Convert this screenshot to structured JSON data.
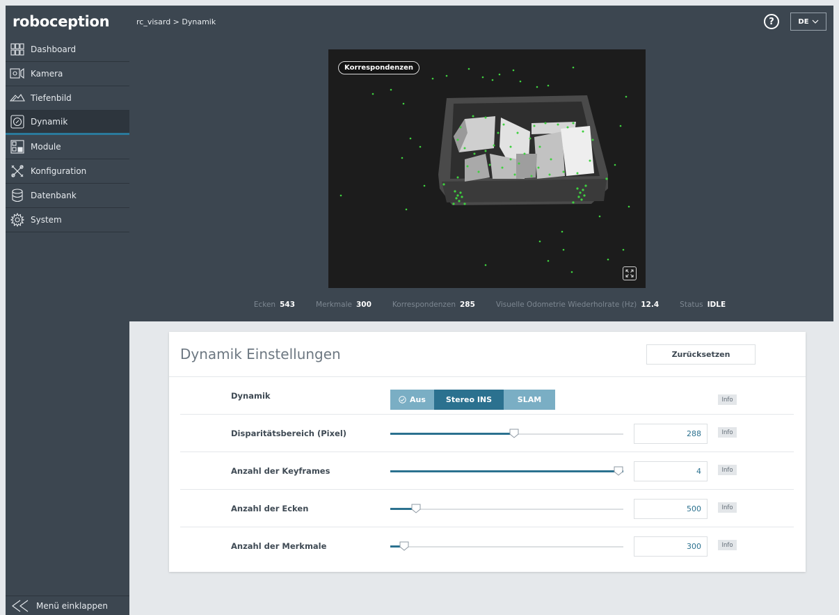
{
  "app": {
    "logo": "roboception"
  },
  "header": {
    "breadcrumb": "rc_visard > Dynamik",
    "help_label": "?",
    "language": "DE"
  },
  "sidebar": {
    "items": [
      {
        "label": "Dashboard",
        "icon": "dashboard-icon"
      },
      {
        "label": "Kamera",
        "icon": "camera-icon"
      },
      {
        "label": "Tiefenbild",
        "icon": "depth-image-icon"
      },
      {
        "label": "Dynamik",
        "icon": "dynamics-icon",
        "active": true
      },
      {
        "label": "Module",
        "icon": "modules-icon"
      },
      {
        "label": "Konfiguration",
        "icon": "configuration-icon"
      },
      {
        "label": "Datenbank",
        "icon": "database-icon"
      },
      {
        "label": "System",
        "icon": "gear-icon"
      }
    ],
    "collapse_label": "Menü einklappen"
  },
  "image_view": {
    "badge": "Korrespondenzen"
  },
  "stats": [
    {
      "label": "Ecken",
      "value": "543"
    },
    {
      "label": "Merkmale",
      "value": "300"
    },
    {
      "label": "Korrespondenzen",
      "value": "285"
    },
    {
      "label": "Visuelle Odometrie Wiederholrate (Hz)",
      "value": "12.4"
    },
    {
      "label": "Status",
      "value": "IDLE"
    }
  ],
  "settings": {
    "title": "Dynamik Einstellungen",
    "reset_label": "Zurücksetzen",
    "info_label": "Info",
    "dynamik": {
      "label": "Dynamik",
      "options": [
        "Aus",
        "Stereo INS",
        "SLAM"
      ],
      "selected": "Stereo INS"
    },
    "sliders": [
      {
        "label": "Disparitätsbereich (Pixel)",
        "value": "288",
        "fraction": 0.53
      },
      {
        "label": "Anzahl der Keyframes",
        "value": "4",
        "fraction": 1.0
      },
      {
        "label": "Anzahl der Ecken",
        "value": "500",
        "fraction": 0.11
      },
      {
        "label": "Anzahl der Merkmale",
        "value": "300",
        "fraction": 0.06
      }
    ]
  },
  "colors": {
    "accent": "#2b718f",
    "accent_light": "#7aaec4",
    "sidebar_bg": "#3c4650",
    "feature_point": "#3fd13f"
  }
}
